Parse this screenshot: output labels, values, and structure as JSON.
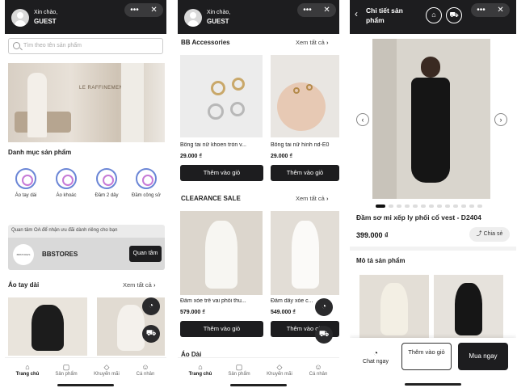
{
  "panel1": {
    "greeting": "Xin chào,",
    "user": "GUEST",
    "pill_more": "•••",
    "pill_close": "✕",
    "search_placeholder": "Tìm theo tên sản phẩm",
    "banner_text": "LE RAFFINEMENT",
    "categories_title": "Danh mục sản phẩm",
    "categories": [
      "Áo tay dài",
      "Áo khoác",
      "Đầm 2 dây",
      "Đầm công sở"
    ],
    "oa_text": "Quan tâm OA để nhận ưu đãi dành riêng cho bạn",
    "oa_logo": "BBSTORE'S",
    "oa_name": "BBSTORES",
    "oa_button": "Quan tâm",
    "section_title": "Áo tay dài",
    "see_all": "Xem tất cả"
  },
  "panel2": {
    "greeting": "Xin chào,",
    "user": "GUEST",
    "pill_more": "•••",
    "pill_close": "✕",
    "section1_title": "BB Accessories",
    "section2_title": "CLEARANCE SALE",
    "section3_title": "Áo Dài",
    "see_all": "Xem tất cả",
    "products1": [
      {
        "name": "Bông tai nữ khoen tròn v...",
        "price": "29.000 ₫"
      },
      {
        "name": "Bông tai nữ hình nd-E0",
        "price": "29.000 ₫"
      }
    ],
    "products2": [
      {
        "name": "Đầm xòe trễ vai phối thu...",
        "price": "579.000 ₫"
      },
      {
        "name": "Đầm dây xòe c...",
        "price": "549.000 ₫"
      }
    ],
    "add_button": "Thêm vào giỏ"
  },
  "panel3": {
    "title": "Chi tiết sản phẩm",
    "pill_more": "•••",
    "pill_close": "✕",
    "product_name": "Đầm sơ mi xếp ly phối cổ vest - D2404",
    "price": "399.000 ₫",
    "share": "Chia sẻ",
    "desc_title": "Mô tả sản phẩm",
    "chat": "Chat ngay",
    "add": "Thêm vào giỏ",
    "buy": "Mua ngay"
  },
  "bottom_nav": [
    "Trang chủ",
    "Sản phẩm",
    "Khuyến mãi",
    "Cá nhân"
  ]
}
